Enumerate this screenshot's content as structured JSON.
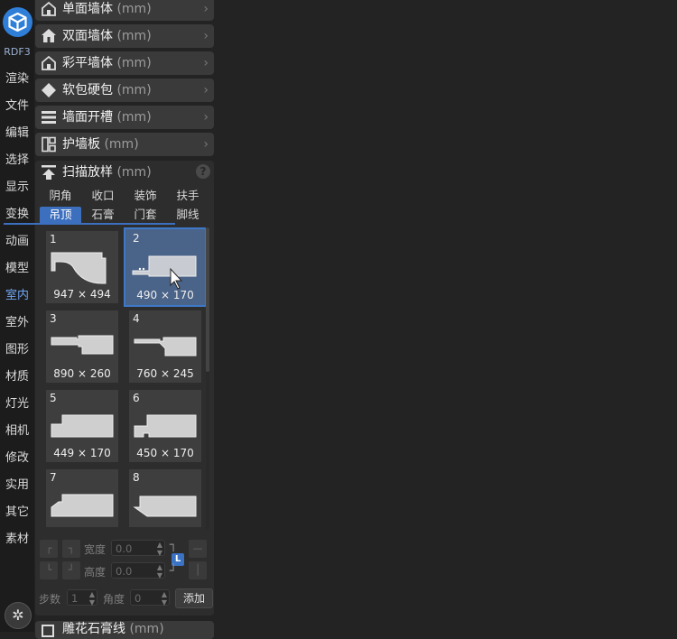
{
  "app": {
    "version": "RDF3",
    "accent_color": "#3c6fbe"
  },
  "sidebar": {
    "items": [
      {
        "label": "渲染"
      },
      {
        "label": "文件"
      },
      {
        "label": "编辑"
      },
      {
        "label": "选择"
      },
      {
        "label": "显示"
      },
      {
        "label": "变换"
      },
      {
        "label": "动画"
      },
      {
        "label": "模型"
      },
      {
        "label": "室内",
        "active": true
      },
      {
        "label": "室外"
      },
      {
        "label": "图形"
      },
      {
        "label": "材质"
      },
      {
        "label": "灯光"
      },
      {
        "label": "相机"
      },
      {
        "label": "修改"
      },
      {
        "label": "实用"
      },
      {
        "label": "其它"
      },
      {
        "label": "素材"
      }
    ]
  },
  "sections": [
    {
      "name": "单面墙体",
      "unit": "(mm)",
      "icon": "house-outline-icon"
    },
    {
      "name": "双面墙体",
      "unit": "(mm)",
      "icon": "house-filled-icon"
    },
    {
      "name": "彩平墙体",
      "unit": "(mm)",
      "icon": "house-outline-icon"
    },
    {
      "name": "软包硬包",
      "unit": "(mm)",
      "icon": "diamond-icon"
    },
    {
      "name": "墙面开槽",
      "unit": "(mm)",
      "icon": "bars-icon"
    },
    {
      "name": "护墙板",
      "unit": "(mm)",
      "icon": "panels-icon"
    }
  ],
  "sweep": {
    "title": "扫描放样",
    "unit": "(mm)",
    "tabs_row1": [
      "阴角",
      "收口",
      "装饰",
      "扶手"
    ],
    "tabs_row2": [
      "吊顶",
      "石膏",
      "门套",
      "脚线"
    ],
    "active_tab": "吊顶",
    "profiles": [
      {
        "num": "1",
        "dims": "947 × 494"
      },
      {
        "num": "2",
        "dims": "490 × 170",
        "selected": true
      },
      {
        "num": "3",
        "dims": "890 × 260"
      },
      {
        "num": "4",
        "dims": "760 × 245"
      },
      {
        "num": "5",
        "dims": "449 × 170"
      },
      {
        "num": "6",
        "dims": "450 × 170"
      },
      {
        "num": "7",
        "dims": ""
      },
      {
        "num": "8",
        "dims": ""
      }
    ],
    "width_label": "宽度",
    "height_label": "高度",
    "width_value": "0.0",
    "height_value": "0.0",
    "steps_label": "步数",
    "steps_value": "1",
    "angle_label": "角度",
    "angle_value": "0",
    "lock_badge": "L",
    "add_label": "添加"
  },
  "bottom_section": {
    "name": "雕花石膏线",
    "unit": "(mm)"
  }
}
